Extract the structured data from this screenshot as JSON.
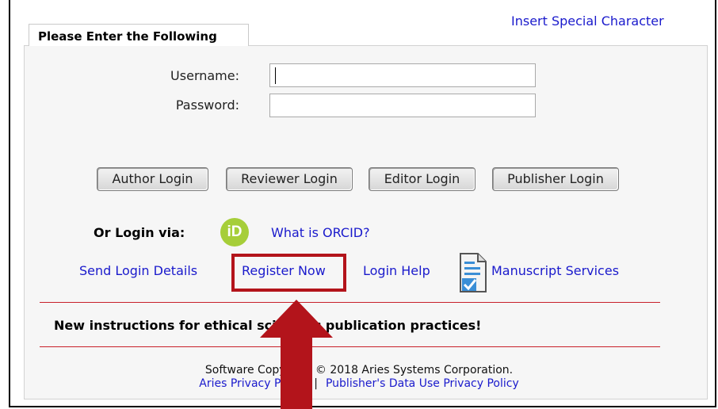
{
  "header": {
    "special_char_link": "Insert Special Character"
  },
  "form": {
    "tab_title": "Please Enter the Following",
    "username_label": "Username:",
    "password_label": "Password:",
    "username_value": "",
    "password_value": ""
  },
  "login_buttons": [
    "Author Login",
    "Reviewer Login",
    "Editor Login",
    "Publisher Login"
  ],
  "orcid": {
    "label": "Or Login via:",
    "icon_text": "iD",
    "icon_color": "#a6ce39",
    "link": "What is ORCID?"
  },
  "links": {
    "send_login": "Send Login Details",
    "register": "Register Now",
    "login_help": "Login Help",
    "manuscript_services": "Manuscript Services"
  },
  "notice": "New instructions for ethical scientific publication practices!",
  "footer": {
    "copyright": "Software Copyright © 2018 Aries Systems Corporation.",
    "privacy": "Aries Privacy Policy",
    "separator": "|",
    "data_use": "Publisher's Data Use Privacy Policy"
  },
  "annotation": {
    "highlight_color": "#b3141b",
    "target": "Register Now"
  },
  "colors": {
    "link": "#1a1acc",
    "rule": "#c8202a"
  }
}
